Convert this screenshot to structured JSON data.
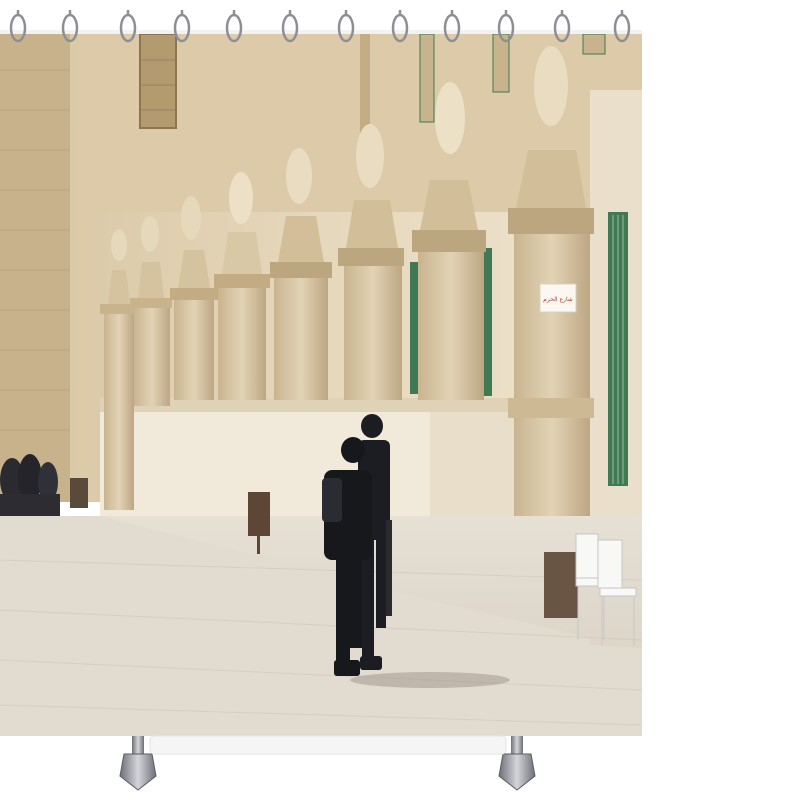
{
  "product": {
    "type": "shower-curtain",
    "ring_count": 12,
    "hook_count": 2
  },
  "photo": {
    "scene": "courtyard-arcade",
    "sign_text": "شارع الحرم",
    "colors": {
      "stone_light": "#eee4d2",
      "stone_mid": "#d9c7a6",
      "stone_dark": "#a88f6a",
      "pavement": "#ddd6ca",
      "window_green": "#3f7a55",
      "uniform": "#1b1d22",
      "ring_metal": "#8e8e96",
      "hook_metal": "#a8a8b0"
    }
  }
}
